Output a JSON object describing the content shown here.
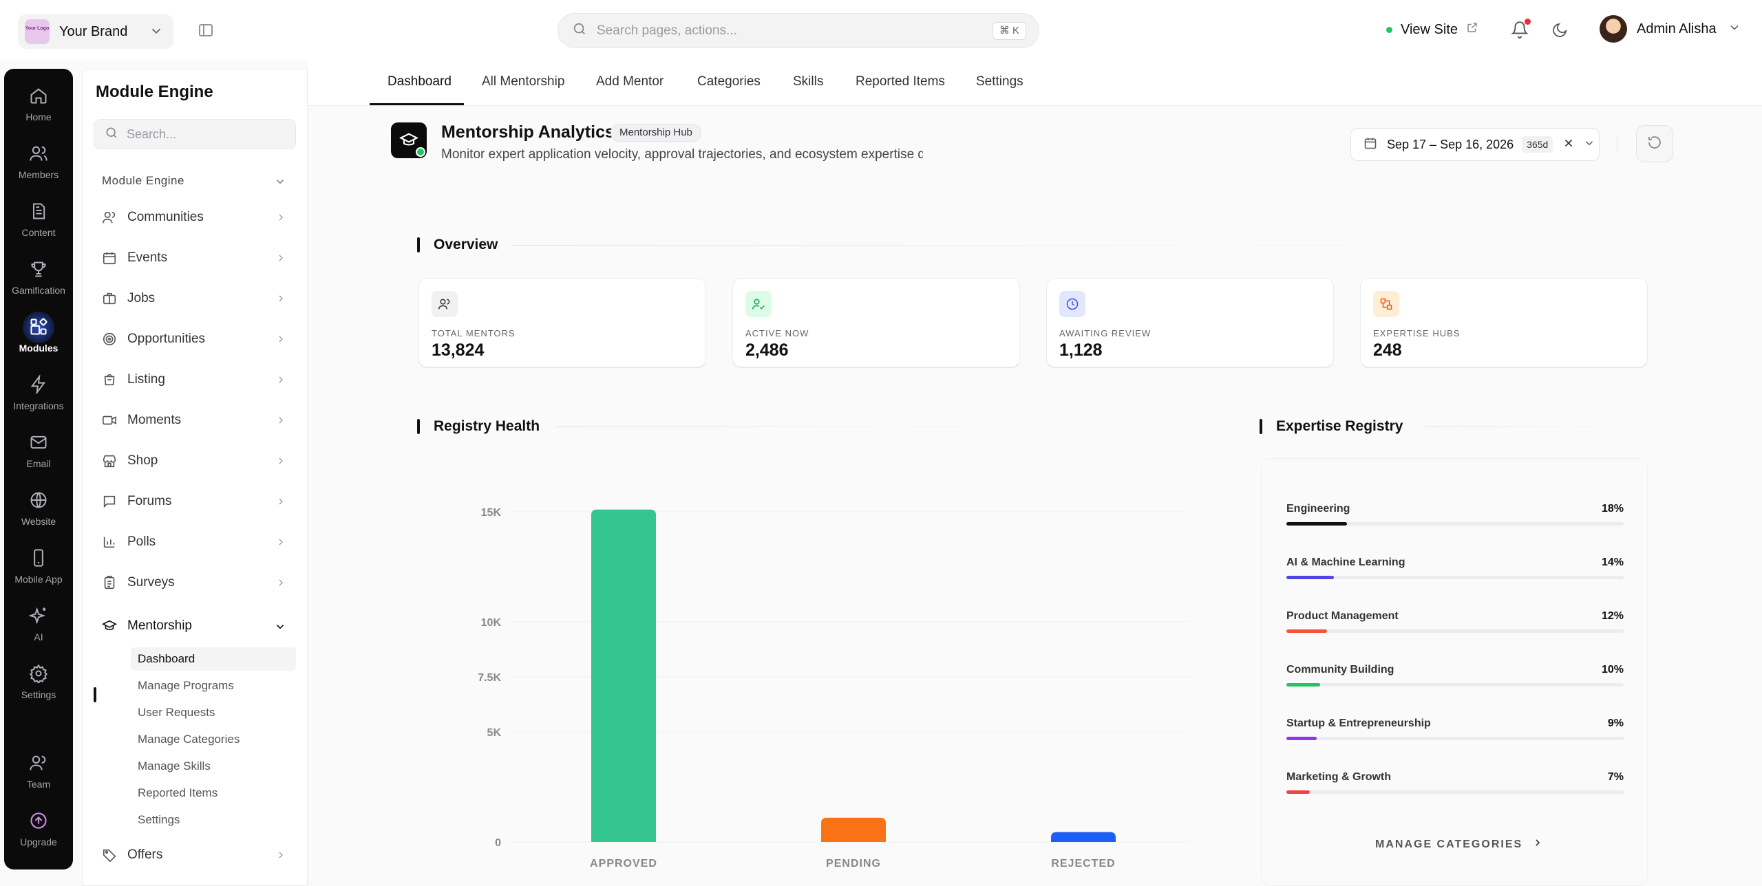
{
  "topbar": {
    "brand_logo": "Your Logo",
    "brand_name": "Your Brand",
    "search_placeholder": "Search pages, actions...",
    "search_shortcut": "⌘ K",
    "view_site": "View Site",
    "user_name": "Admin Alisha"
  },
  "rail": [
    {
      "label": "Home",
      "icon": "home-icon"
    },
    {
      "label": "Members",
      "icon": "members-icon"
    },
    {
      "label": "Content",
      "icon": "content-icon"
    },
    {
      "label": "Gamification",
      "icon": "trophy-icon"
    },
    {
      "label": "Modules",
      "icon": "modules-icon",
      "active": true
    },
    {
      "label": "Integrations",
      "icon": "bolt-icon"
    },
    {
      "label": "Email",
      "icon": "mail-icon"
    },
    {
      "label": "Website",
      "icon": "globe-icon"
    },
    {
      "label": "Mobile App",
      "icon": "phone-icon"
    },
    {
      "label": "AI",
      "icon": "sparkles-icon"
    },
    {
      "label": "Settings",
      "icon": "gear-icon"
    },
    {
      "label": "Team",
      "icon": "team-icon"
    },
    {
      "label": "Upgrade",
      "icon": "upgrade-icon"
    }
  ],
  "module_panel": {
    "title": "Module Engine",
    "search_placeholder": "Search...",
    "section": "Module Engine",
    "items": [
      {
        "label": "Communities",
        "icon": "users-icon"
      },
      {
        "label": "Events",
        "icon": "calendar-icon"
      },
      {
        "label": "Jobs",
        "icon": "briefcase-icon"
      },
      {
        "label": "Opportunities",
        "icon": "target-icon"
      },
      {
        "label": "Listing",
        "icon": "listing-icon"
      },
      {
        "label": "Moments",
        "icon": "video-icon"
      },
      {
        "label": "Shop",
        "icon": "store-icon"
      },
      {
        "label": "Forums",
        "icon": "chat-icon"
      },
      {
        "label": "Polls",
        "icon": "bar-chart-icon"
      },
      {
        "label": "Surveys",
        "icon": "clipboard-icon"
      },
      {
        "label": "Mentorship",
        "icon": "graduation-cap-icon"
      }
    ],
    "sub_items": [
      "Dashboard",
      "Manage Programs",
      "User Requests",
      "Manage Categories",
      "Manage Skills",
      "Reported Items",
      "Settings"
    ],
    "last_item": {
      "label": "Offers",
      "icon": "tag-icon"
    }
  },
  "tabs": [
    "Dashboard",
    "All Mentorship",
    "Add Mentor",
    "Categories",
    "Skills",
    "Reported Items",
    "Settings"
  ],
  "page_header": {
    "title": "Mentorship Analytics",
    "badge": "Mentorship Hub",
    "subtitle": "Monitor expert application velocity, approval trajectories, and ecosystem expertise distrib",
    "date_range": "Sep 17 – Sep 16, 2026",
    "date_days": "365d"
  },
  "overview": {
    "title": "Overview",
    "stats": [
      {
        "label": "TOTAL MENTORS",
        "value": "13,824",
        "icon": "users-icon",
        "color": "#f1f1f3"
      },
      {
        "label": "ACTIVE NOW",
        "value": "2,486",
        "icon": "user-check-icon",
        "color": "#dcfce7"
      },
      {
        "label": "AWAITING REVIEW",
        "value": "1,128",
        "icon": "clock-icon",
        "color": "#e0e7ff"
      },
      {
        "label": "EXPERTISE HUBS",
        "value": "248",
        "icon": "hub-icon",
        "color": "#ffedd5"
      }
    ]
  },
  "registry_health": {
    "title": "Registry Health",
    "chart_data": {
      "type": "bar",
      "categories": [
        "APPROVED",
        "PENDING",
        "REJECTED"
      ],
      "values": [
        15100,
        1100,
        450
      ],
      "colors": [
        "#34c591",
        "#f97316",
        "#1d5ff5"
      ],
      "yticks": [
        0,
        5000,
        7500,
        10000,
        15000
      ],
      "ytick_labels": [
        "0",
        "5K",
        "7.5K",
        "10K",
        "15K"
      ],
      "ylim": [
        0,
        15000
      ]
    }
  },
  "expertise_registry": {
    "title": "Expertise Registry",
    "rows": [
      {
        "name": "Engineering",
        "percent": "18%",
        "value": 18,
        "color": "#111111"
      },
      {
        "name": "AI & Machine Learning",
        "percent": "14%",
        "value": 14,
        "color": "#4f46e5"
      },
      {
        "name": "Product Management",
        "percent": "12%",
        "value": 12,
        "color": "#f4553b"
      },
      {
        "name": "Community Building",
        "percent": "10%",
        "value": 10,
        "color": "#22c55e"
      },
      {
        "name": "Startup & Entrepreneurship",
        "percent": "9%",
        "value": 9,
        "color": "#9333ea"
      },
      {
        "name": "Marketing & Growth",
        "percent": "7%",
        "value": 7,
        "color": "#ef4444"
      }
    ],
    "manage_label": "MANAGE CATEGORIES"
  }
}
